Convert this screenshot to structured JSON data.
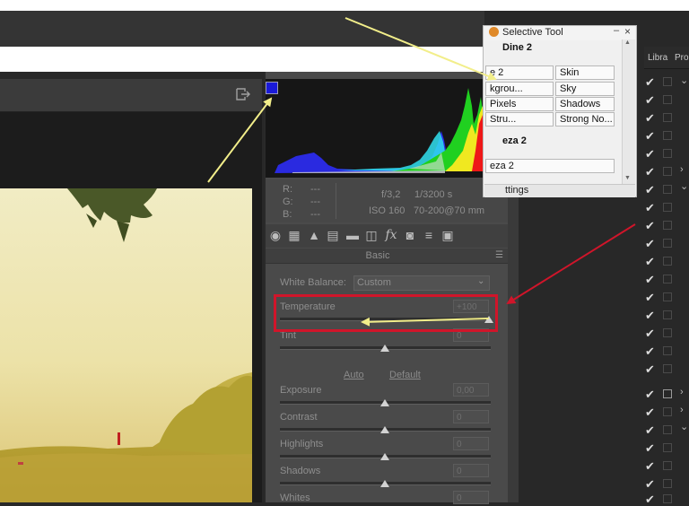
{
  "acr": {
    "info": {
      "r_label": "R:",
      "g_label": "G:",
      "b_label": "B:",
      "r_val": "---",
      "g_val": "---",
      "b_val": "---",
      "aperture": "f/3,2",
      "shutter": "1/3200 s",
      "iso": "ISO 160",
      "lens": "70-200@70 mm"
    },
    "tools": [
      "basic-icon",
      "tone-curve-icon",
      "detail-icon",
      "hsl-icon",
      "split-toning-icon",
      "lens-icon",
      "fx-icon",
      "camera-calibration-icon",
      "presets-icon",
      "snapshots-icon"
    ],
    "tool_glyphs": [
      "◉",
      "▦",
      "▲",
      "▤",
      "▬",
      "◫",
      "fx",
      "◙",
      "≡",
      "▣"
    ],
    "basic": {
      "title": "Basic",
      "white_balance_label": "White Balance:",
      "white_balance_value": "Custom",
      "auto": "Auto",
      "default": "Default",
      "sliders": [
        {
          "label": "Temperature",
          "value": "+100",
          "level": 1.0
        },
        {
          "label": "Tint",
          "value": "0",
          "level": 0.5
        },
        {
          "label": "Exposure",
          "value": "0,00",
          "level": 0.5
        },
        {
          "label": "Contrast",
          "value": "0",
          "level": 0.5
        },
        {
          "label": "Highlights",
          "value": "0",
          "level": 0.5
        },
        {
          "label": "Shadows",
          "value": "0",
          "level": 0.5
        },
        {
          "label": "Whites",
          "value": "0",
          "level": 0.5
        }
      ]
    }
  },
  "selective_tool": {
    "title": "Selective Tool",
    "group1": "Dine 2",
    "buttons1": [
      "e 2",
      "Skin",
      "kgrou...",
      "Sky",
      "Pixels",
      "Shadows",
      "Stru...",
      "Strong No..."
    ],
    "group2": "eza 2",
    "button2": "eza 2",
    "bottom_tab": "ttings"
  },
  "right_panel": {
    "tab1": "Libra",
    "tab2": "Pro"
  },
  "colors": {
    "annotation_yellow": "#f2ee8a",
    "annotation_red": "#d0152a",
    "clip_shadow": "#1a1ad8",
    "clip_highlight": "#e01010"
  }
}
